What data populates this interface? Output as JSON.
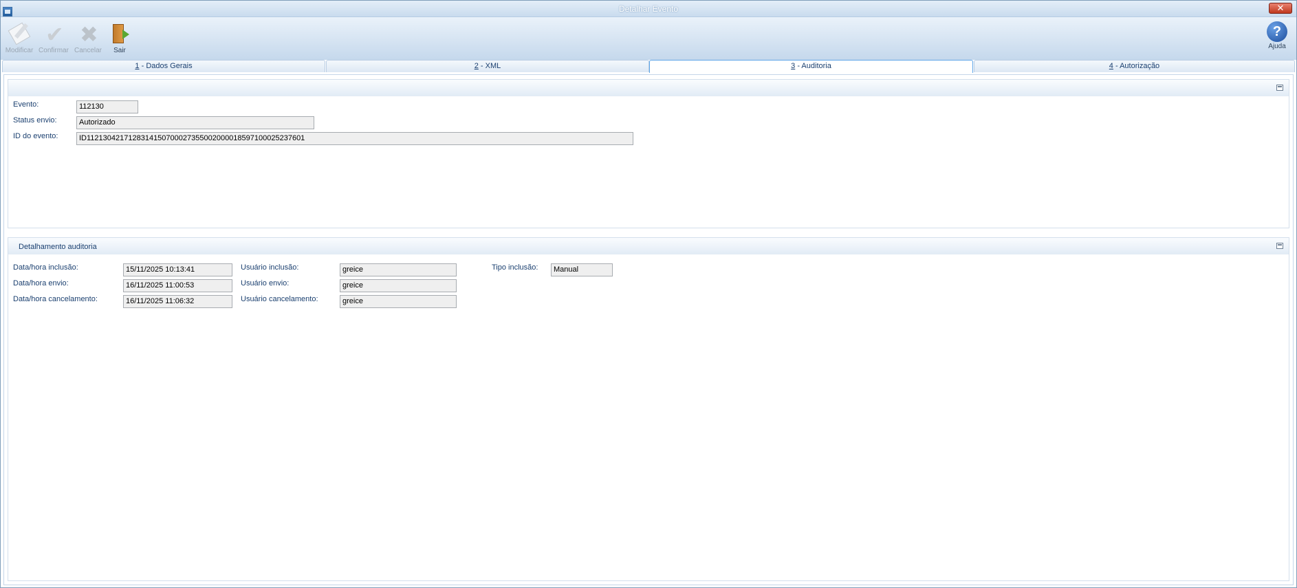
{
  "window": {
    "title": "Detalhar Evento",
    "close_glyph": "✕"
  },
  "toolbar": {
    "items": [
      {
        "label": "Modificar",
        "icon": "edit-icon",
        "enabled": false
      },
      {
        "label": "Confirmar",
        "icon": "check-icon",
        "enabled": false
      },
      {
        "label": "Cancelar",
        "icon": "cancel-icon",
        "enabled": false
      },
      {
        "label": "Sair",
        "icon": "exit-door-icon",
        "enabled": true
      }
    ],
    "help": {
      "label": "Ajuda",
      "icon": "help-icon",
      "glyph": "?"
    }
  },
  "tabs": [
    {
      "key": "1",
      "label": " - Dados Gerais",
      "active": false
    },
    {
      "key": "2",
      "label": " - XML",
      "active": false
    },
    {
      "key": "3",
      "label": " - Auditoria",
      "active": true
    },
    {
      "key": "4",
      "label": " - Autorização",
      "active": false
    }
  ],
  "evento_panel": {
    "title": "",
    "fields": {
      "evento": {
        "label": "Evento:",
        "value": "112130"
      },
      "status_envio": {
        "label": "Status envio:",
        "value": "Autorizado"
      },
      "id_evento": {
        "label": "ID do evento:",
        "value": "ID1121304217128314150700027355002000018597100025237601"
      }
    }
  },
  "auditoria_panel": {
    "title": "Detalhamento auditoria",
    "data_inclusao": {
      "label": "Data/hora inclusão:",
      "value": "15/11/2025 10:13:41"
    },
    "data_envio": {
      "label": "Data/hora envio:",
      "value": "16/11/2025 11:00:53"
    },
    "data_cancelamento": {
      "label": "Data/hora cancelamento:",
      "value": "16/11/2025 11:06:32"
    },
    "usuario_inclusao": {
      "label": "Usuário inclusão:",
      "value": "greice"
    },
    "usuario_envio": {
      "label": "Usuário envio:",
      "value": "greice"
    },
    "usuario_cancelamento": {
      "label": "Usuário cancelamento:",
      "value": "greice"
    },
    "tipo_inclusao": {
      "label": "Tipo inclusão:",
      "value": "Manual"
    }
  },
  "colors": {
    "label_text": "#1a3f6f",
    "tab_active_border": "#5ea6e8",
    "close_button": "#c0391f"
  }
}
